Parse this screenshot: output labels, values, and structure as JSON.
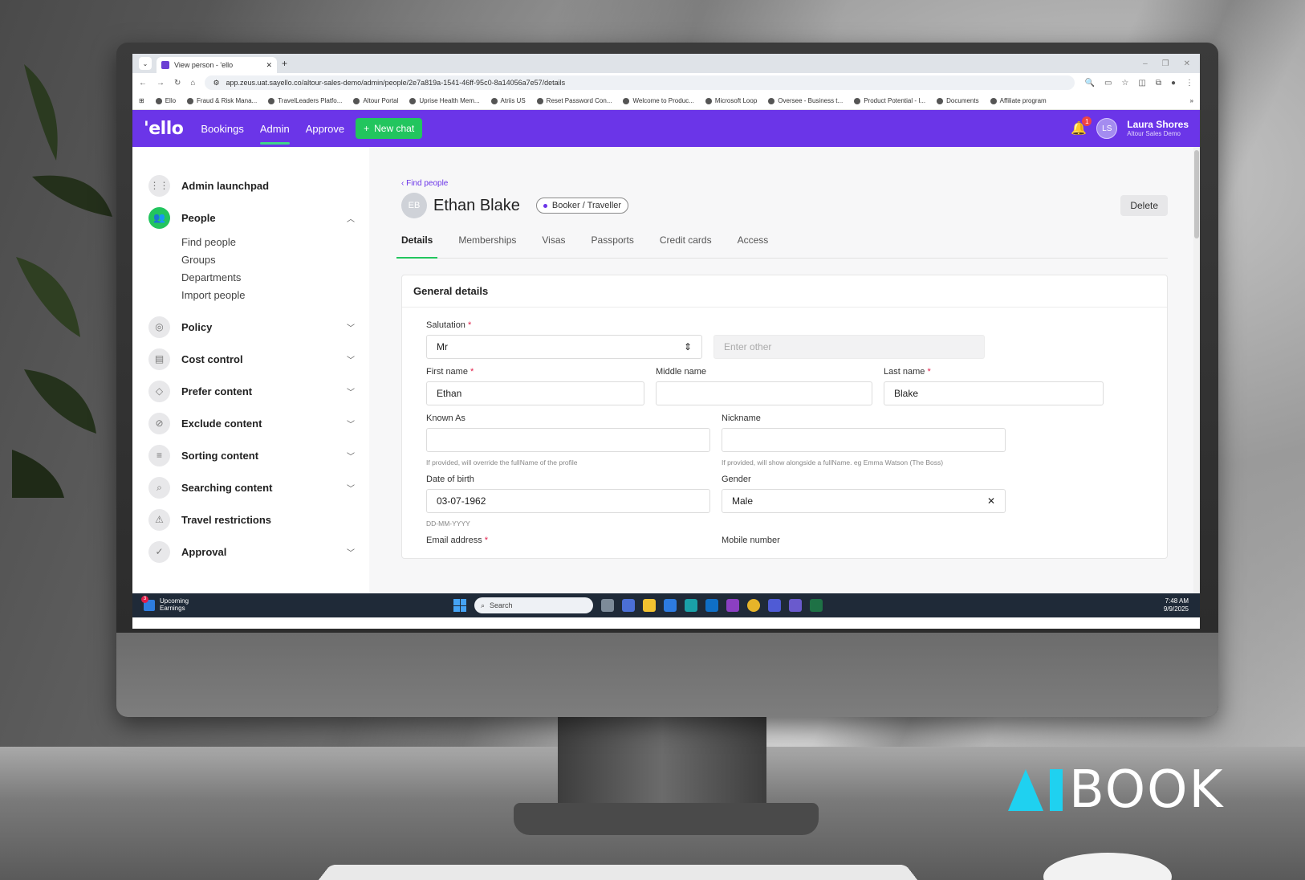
{
  "browser": {
    "tab_title": "View person - 'ello",
    "url": "app.zeus.uat.sayello.co/altour-sales-demo/admin/people/2e7a819a-1541-46ff-95c0-8a14056a7e57/details",
    "bookmarks": [
      "Ello",
      "Fraud & Risk Mana...",
      "TravelLeaders Platfo...",
      "Altour Portal",
      "Uprise Health Mem...",
      "Atriis US",
      "Reset Password Con...",
      "Welcome to Produc...",
      "Microsoft Loop",
      "Oversee - Business t...",
      "Product Potential - I...",
      "Documents",
      "Affiliate program"
    ]
  },
  "header": {
    "logo": "'ello",
    "nav": [
      "Bookings",
      "Admin",
      "Approve"
    ],
    "active_nav": "Admin",
    "new_chat": "New chat",
    "notification_count": "1",
    "user_initials": "LS",
    "user_name": "Laura Shores",
    "user_org": "Altour Sales Demo",
    "brand_color": "#6b35e8",
    "accent_color": "#22c55e"
  },
  "sidebar": {
    "items": [
      {
        "label": "Admin launchpad",
        "icon": "grid-icon"
      },
      {
        "label": "People",
        "icon": "people-icon",
        "expanded": true
      },
      {
        "label": "Policy",
        "icon": "policy-icon"
      },
      {
        "label": "Cost control",
        "icon": "cost-icon"
      },
      {
        "label": "Prefer content",
        "icon": "tag-icon"
      },
      {
        "label": "Exclude content",
        "icon": "block-icon"
      },
      {
        "label": "Sorting content",
        "icon": "sort-icon"
      },
      {
        "label": "Searching content",
        "icon": "search-icon"
      },
      {
        "label": "Travel restrictions",
        "icon": "warning-icon"
      },
      {
        "label": "Approval",
        "icon": "approval-icon"
      }
    ],
    "people_sub": [
      "Find people",
      "Groups",
      "Departments",
      "Import people"
    ]
  },
  "page": {
    "back_link": "Find people",
    "initials": "EB",
    "name": "Ethan Blake",
    "role": "Booker / Traveller",
    "delete": "Delete",
    "tabs": [
      "Details",
      "Memberships",
      "Visas",
      "Passports",
      "Credit cards",
      "Access"
    ],
    "active_tab": "Details"
  },
  "form": {
    "section_title": "General details",
    "salutation_label": "Salutation",
    "salutation_value": "Mr",
    "other_placeholder": "Enter other",
    "first_name_label": "First name",
    "first_name_value": "Ethan",
    "middle_name_label": "Middle name",
    "middle_name_value": "",
    "last_name_label": "Last name",
    "last_name_value": "Blake",
    "known_as_label": "Known As",
    "known_as_hint": "If provided, will override the fullName of the profile",
    "nickname_label": "Nickname",
    "nickname_hint": "If provided, will show alongside a fullName. eg Emma Watson (The Boss)",
    "dob_label": "Date of birth",
    "dob_value": "03-07-1962",
    "dob_hint": "DD-MM-YYYY",
    "gender_label": "Gender",
    "gender_value": "Male",
    "email_label": "Email address",
    "mobile_label": "Mobile number"
  },
  "taskbar": {
    "widget_count": "3",
    "widget_line1": "Upcoming",
    "widget_line2": "Earnings",
    "search": "Search",
    "time": "7:48 AM",
    "date": "9/9/2025"
  },
  "watermark": {
    "word": "BOOK"
  }
}
